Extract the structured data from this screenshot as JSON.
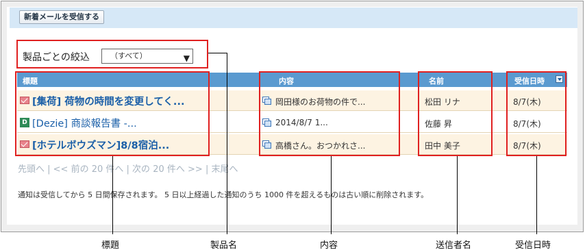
{
  "toolbar": {
    "receive_button": "新着メールを受信する"
  },
  "filter": {
    "label": "製品ごとの絞込",
    "selected": "（すべて）"
  },
  "table": {
    "headers": {
      "title": "標題",
      "content": "内容",
      "sender": "名前",
      "date": "受信日時"
    },
    "rows": [
      {
        "title": "[集荷] 荷物の時間を変更してく...",
        "content": "岡田様のお荷物の件で...",
        "sender": "松田 リナ",
        "date": "8/7(木)",
        "icon": "mail-icon"
      },
      {
        "title": "[Dezie] 商談報告書 -...",
        "content": "2014/8/7 1...",
        "sender": "佐藤 昇",
        "date": "8/7(木)",
        "icon": "dezie-icon"
      },
      {
        "title": "[ホテルボウズマン]8/8宿泊...",
        "content": "高橋さん。おつかれさ...",
        "sender": "田中 美子",
        "date": "8/7(木)",
        "icon": "mail-icon"
      }
    ]
  },
  "pager": {
    "first": "先頭へ",
    "prev": "| << 前の 20 件へ",
    "next": "| 次の 20 件へ >>",
    "last": "| 末尾へ"
  },
  "notice": "通知は受信してから 5 日間保存されます。 5 日以上経過した通知のうち 1000 件を超えるものは古い順に削除されます。",
  "callouts": {
    "title": "標題",
    "product": "製品名",
    "content": "内容",
    "sender": "送信者名",
    "date": "受信日時"
  },
  "colors": {
    "header": "#5a9ad0",
    "row_alt": "#fdf3e2",
    "link": "#1a5fa8",
    "highlight": "#e02020"
  }
}
